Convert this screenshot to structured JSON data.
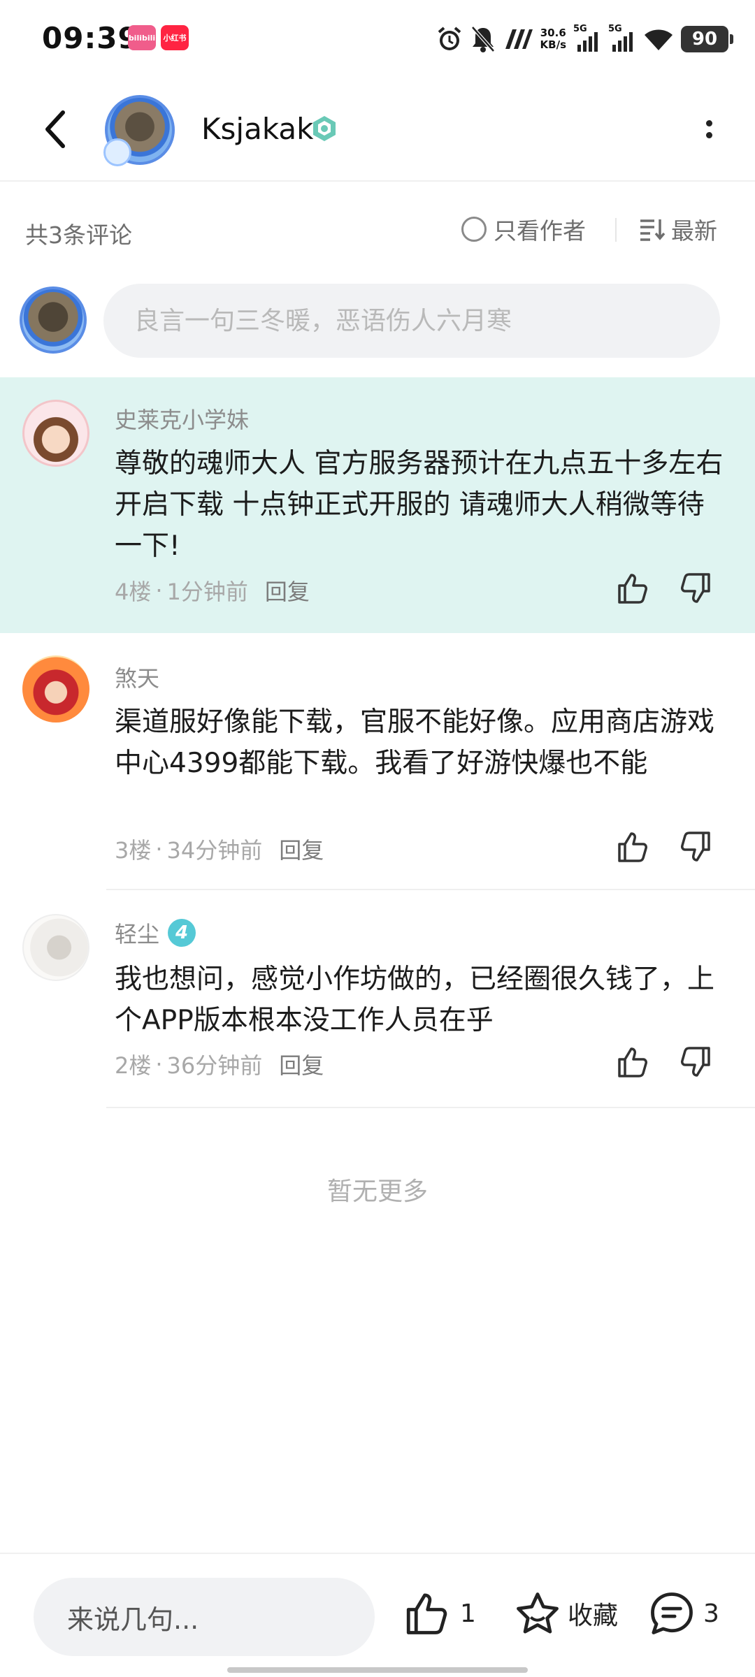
{
  "status_bar": {
    "time": "09:39",
    "app_badges": [
      "bilibili",
      "小红书"
    ],
    "net_speed": "30.6",
    "net_speed_unit": "KB/s",
    "signal_1": "5G",
    "signal_2": "5G",
    "battery": "90",
    "icons": [
      "alarm-icon",
      "bell-off-icon",
      "nfc-icon",
      "signal-icon",
      "signal-icon",
      "wifi-icon",
      "battery-icon"
    ]
  },
  "header": {
    "name": "Ksjakak",
    "back_icon": "chevron-left-icon",
    "verified_icon": "verified-badge-icon",
    "more_icon": "more-vertical-icon"
  },
  "filter": {
    "count_text": "共3条评论",
    "author_only": "只看作者",
    "sort": "最新"
  },
  "composer": {
    "placeholder": "良言一句三冬暖，恶语伤人六月寒"
  },
  "comments": [
    {
      "user": "史莱克小学妹",
      "text": "尊敬的魂师大人  官方服务器预计在九点五十多左右开启下载 十点钟正式开服的 请魂师大人稍微等待一下!",
      "floor": "4楼",
      "time": "1分钟前",
      "reply": "回复",
      "highlighted": true
    },
    {
      "user": "煞天",
      "text": "渠道服好像能下载，官服不能好像。应用商店游戏中心4399都能下载。我看了好游快爆也不能",
      "floor": "3楼",
      "time": "34分钟前",
      "reply": "回复",
      "highlighted": false
    },
    {
      "user": "轻尘",
      "level": "4",
      "text": "我也想问，感觉小作坊做的，已经圈很久钱了，上个APP版本根本没工作人员在乎",
      "floor": "2楼",
      "time": "36分钟前",
      "reply": "回复",
      "highlighted": false
    }
  ],
  "meta_separator": "·",
  "no_more": "暂无更多",
  "bottom_bar": {
    "input_placeholder": "来说几句...",
    "like_count": "1",
    "favorite_label": "收藏",
    "comment_count": "3"
  },
  "colors": {
    "highlight_bg": "#dff4f1",
    "accent_teal": "#55c9d6",
    "text_secondary": "#8c8c8c"
  }
}
